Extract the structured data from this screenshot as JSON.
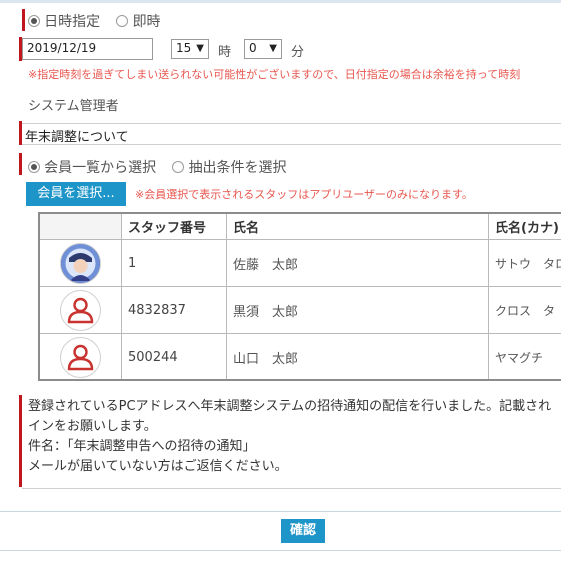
{
  "delivery": {
    "options": [
      "日時指定",
      "即時"
    ],
    "selected": "日時指定",
    "date": "2019/12/19",
    "hour": "15",
    "hour_unit": "時",
    "minute": "0",
    "minute_unit": "分",
    "warning": "※指定時刻を過ぎてしまい送られない可能性がございますので、日付指定の場合は余裕を持って時刻"
  },
  "sender": {
    "label": "システム管理者"
  },
  "subject": {
    "value": "年末調整について"
  },
  "member_source": {
    "options": [
      "会員一覧から選択",
      "抽出条件を選択"
    ],
    "selected": "会員一覧から選択"
  },
  "select_members": {
    "button_label": "会員を選択...",
    "note": "※会員選択で表示されるスタッフはアプリユーザーのみになります。"
  },
  "members_table": {
    "headers": [
      "",
      "スタッフ番号",
      "氏名",
      "氏名(カナ)"
    ],
    "rows": [
      {
        "avatar": "user-photo-icon",
        "staff_no": "1",
        "name": "佐藤　太郎",
        "kana": "サトウ　タロ"
      },
      {
        "avatar": "user-placeholder-icon",
        "staff_no": "4832837",
        "name": "黒須　太郎",
        "kana": "クロス　タ"
      },
      {
        "avatar": "user-placeholder-icon",
        "staff_no": "500244",
        "name": "山口　太郎",
        "kana": "ヤマグチ　"
      }
    ]
  },
  "message": {
    "lines": [
      "登録されているPCアドレスへ年末調整システムの招待通知の配信を行いました。記載され",
      "インをお願いします。",
      "件名：「年末調整申告への招待の通知」",
      "メールが届いていない方はご返信ください。"
    ]
  },
  "footer": {
    "confirm_label": "確認"
  },
  "colors": {
    "accent_red": "#c0171f",
    "warning_text": "#e8574f",
    "button_blue": "#1e95c9",
    "avatar_red": "#c8322f"
  }
}
